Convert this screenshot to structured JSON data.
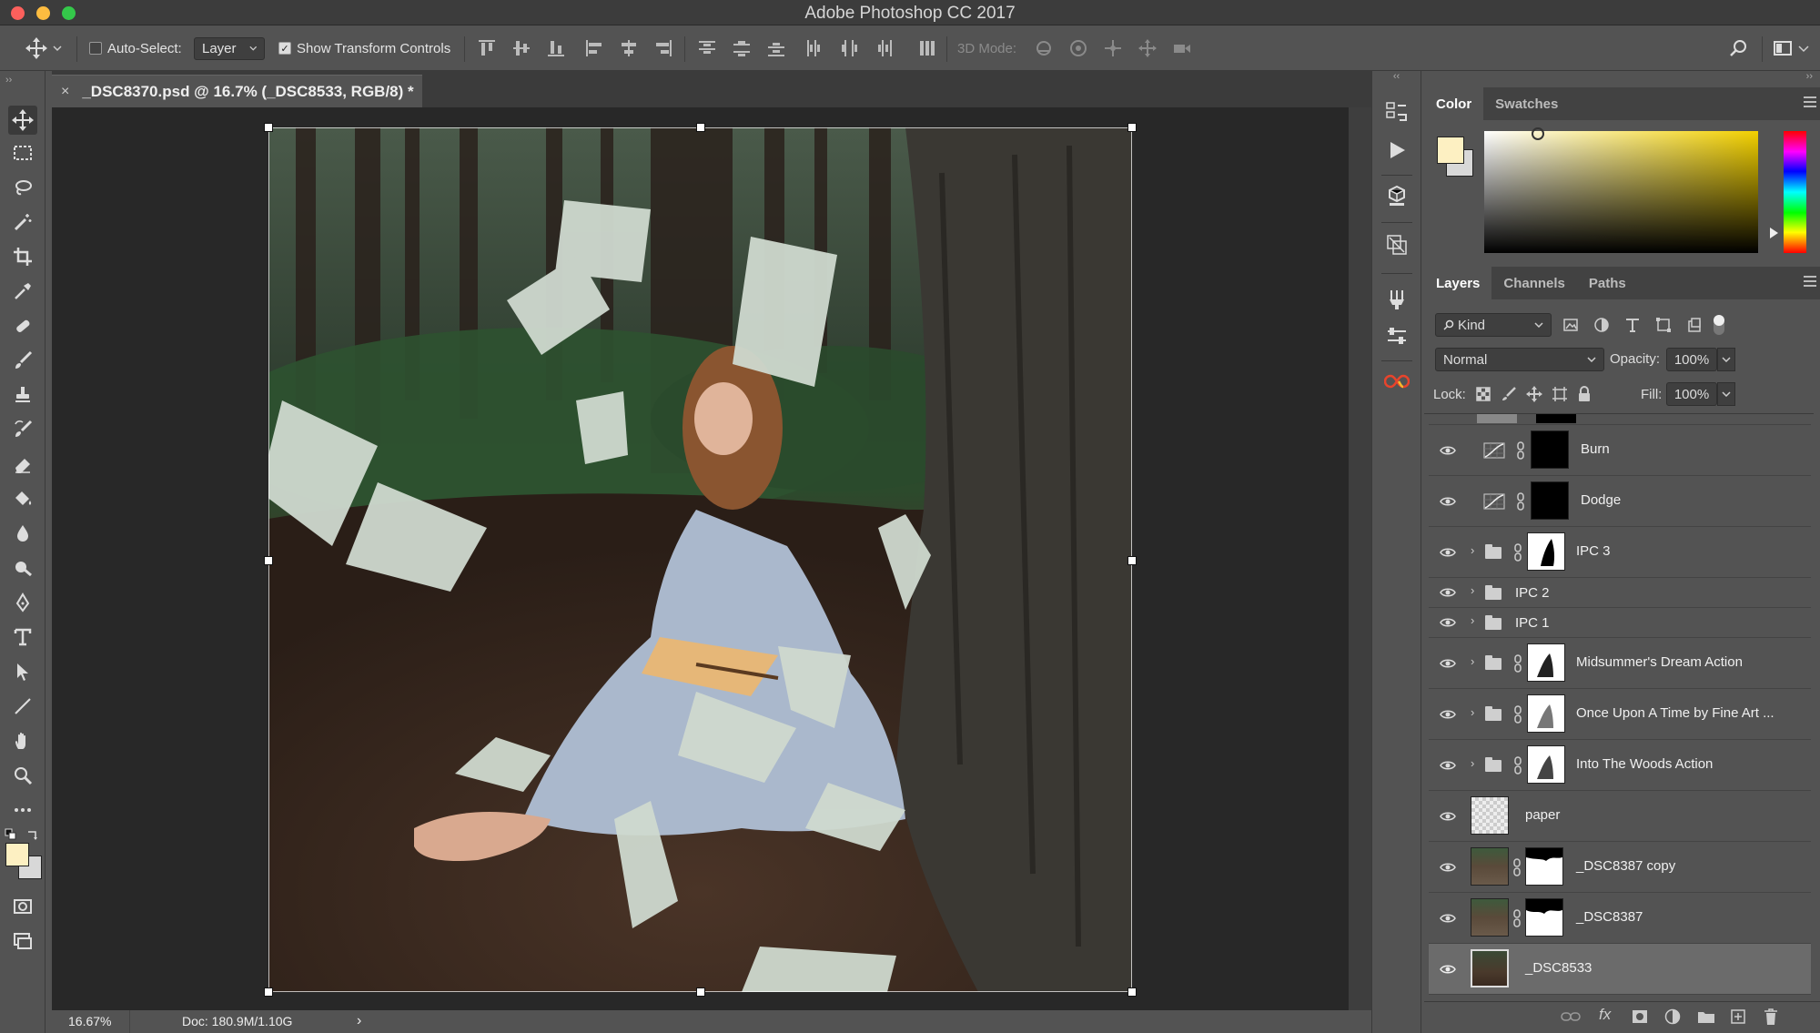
{
  "app": {
    "window_title": "Adobe Photoshop CC 2017"
  },
  "options_bar": {
    "auto_select_label": "Auto-Select:",
    "auto_select_checked": false,
    "auto_select_target": "Layer",
    "show_transform_label": "Show Transform Controls",
    "show_transform_checked": true,
    "mode_3d_label": "3D Mode:"
  },
  "document": {
    "tab_title": "_DSC8370.psd @ 16.7% (_DSC8533, RGB/8) *",
    "close_glyph": "×"
  },
  "status": {
    "zoom": "16.67%",
    "doc_size": "Doc: 180.9M/1.10G",
    "arrow": "›"
  },
  "color_panel": {
    "tabs": [
      "Color",
      "Swatches"
    ],
    "foreground": "#fdf0c2",
    "background": "#d8d8d8"
  },
  "layers_panel": {
    "tabs": [
      "Layers",
      "Channels",
      "Paths"
    ],
    "filter_kind": "Kind",
    "blend_mode": "Normal",
    "opacity_label": "Opacity:",
    "opacity": "100%",
    "lock_label": "Lock:",
    "fill_label": "Fill:",
    "fill": "100%",
    "layers": [
      {
        "name": "Burn",
        "kind": "curves-adjustment"
      },
      {
        "name": "Dodge",
        "kind": "curves-adjustment"
      },
      {
        "name": "IPC 3",
        "kind": "group-masked"
      },
      {
        "name": "IPC 2",
        "kind": "group"
      },
      {
        "name": "IPC 1",
        "kind": "group"
      },
      {
        "name": "Midsummer's Dream Action",
        "kind": "group-masked"
      },
      {
        "name": "Once Upon A Time by Fine Art ...",
        "kind": "group-masked"
      },
      {
        "name": "Into The Woods Action",
        "kind": "group-masked"
      },
      {
        "name": "paper",
        "kind": "pixel"
      },
      {
        "name": "_DSC8387 copy",
        "kind": "pixel-masked"
      },
      {
        "name": "_DSC8387",
        "kind": "pixel-masked"
      },
      {
        "name": "_DSC8533",
        "kind": "pixel",
        "selected": true
      }
    ]
  },
  "colors": {
    "ui_bg": "#535353",
    "canvas_bg": "#282828",
    "selected_row": "#6b6b6b",
    "accent_yellow": "#fdf0c2"
  }
}
